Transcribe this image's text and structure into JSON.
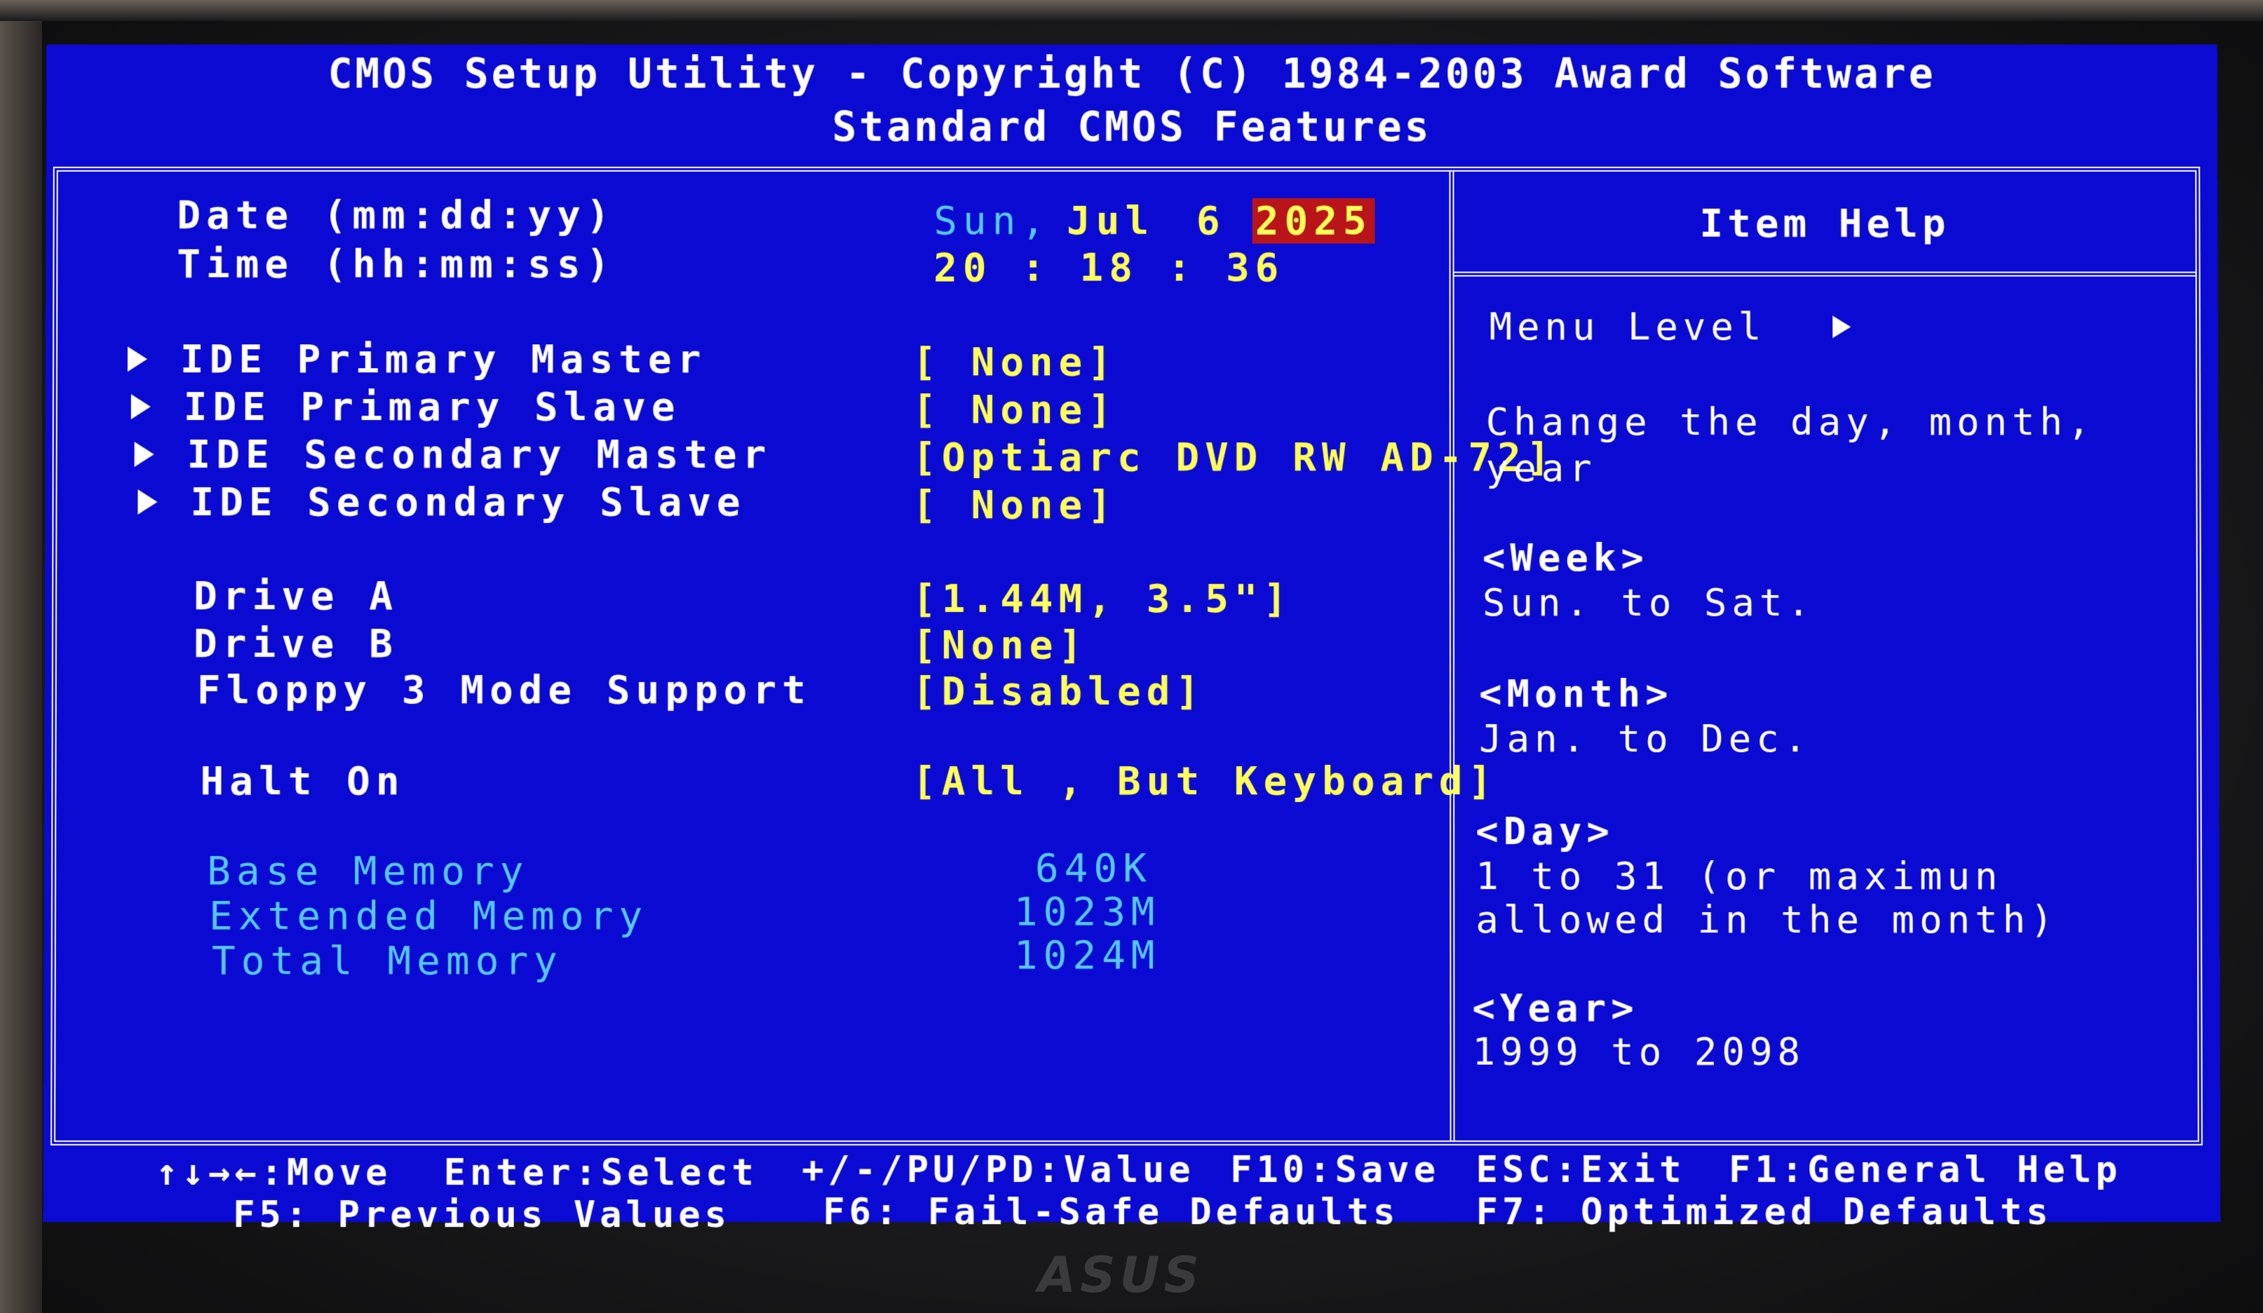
{
  "header": {
    "line1": "CMOS Setup Utility - Copyright (C) 1984-2003 Award Software",
    "line2": "Standard CMOS Features"
  },
  "date": {
    "label": "Date (mm:dd:yy)",
    "weekday": "Sun,",
    "month": "Jul",
    "day": "6",
    "year": "2025"
  },
  "time": {
    "label": "Time (hh:mm:ss)",
    "value": "20 : 18 : 36"
  },
  "ide": [
    {
      "label": "IDE Primary Master",
      "value": "[ None]"
    },
    {
      "label": "IDE Primary Slave",
      "value": "[ None]"
    },
    {
      "label": "IDE Secondary Master",
      "value": "[Optiarc DVD RW AD-72]"
    },
    {
      "label": "IDE Secondary Slave",
      "value": "[ None]"
    }
  ],
  "drives": [
    {
      "label": "Drive A",
      "value": "[1.44M, 3.5\"]"
    },
    {
      "label": "Drive B",
      "value": "[None]"
    },
    {
      "label": "Floppy 3 Mode Support",
      "value": "[Disabled]"
    }
  ],
  "halt": {
    "label": "Halt On",
    "value": "[All , But Keyboard]"
  },
  "memory": [
    {
      "label": "Base Memory",
      "value": "640K"
    },
    {
      "label": "Extended Memory",
      "value": "1023M"
    },
    {
      "label": "Total Memory",
      "value": "1024M"
    }
  ],
  "help": {
    "title": "Item Help",
    "menu_level": "Menu Level",
    "desc1": "Change the day, month,",
    "desc2": "year",
    "week_title": "<Week>",
    "week_text": "Sun. to Sat.",
    "month_title": "<Month>",
    "month_text": "Jan. to Dec.",
    "day_title": "<Day>",
    "day_text1": "1 to 31 (or maximun",
    "day_text2": "allowed in the month)",
    "year_title": "<Year>",
    "year_text": "1999 to 2098"
  },
  "footer": {
    "move": "↑↓→←:Move",
    "select": "Enter:Select",
    "value": "+/-/PU/PD:Value",
    "save": "F10:Save",
    "exit": "ESC:Exit",
    "general_help": "F1:General Help",
    "previous": "F5: Previous Values",
    "failsafe": "F6: Fail-Safe Defaults",
    "optimized": "F7: Optimized Defaults"
  },
  "monitor_brand": "ASUS",
  "colors": {
    "background": "#0a0ad2",
    "selected_highlight": "#b8141a",
    "value_yellow": "#ffff55",
    "info_cyan": "#55c8ff"
  }
}
